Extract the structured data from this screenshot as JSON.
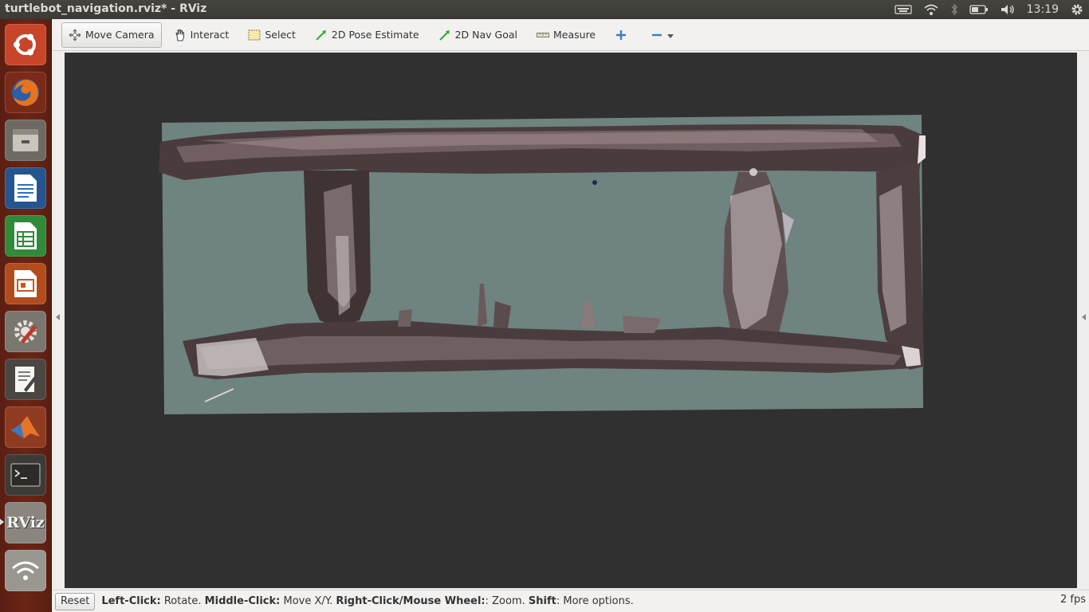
{
  "window": {
    "title": "turtlebot_navigation.rviz* - RViz"
  },
  "tray": {
    "clock": "13:19",
    "icons": [
      "keyboard-icon",
      "wifi-icon",
      "bluetooth-icon",
      "battery-icon",
      "volume-icon",
      "settings-gear-icon"
    ]
  },
  "launcher": {
    "items": [
      {
        "name": "ubuntu-dash-icon"
      },
      {
        "name": "firefox-icon"
      },
      {
        "name": "files-icon"
      },
      {
        "name": "writer-icon"
      },
      {
        "name": "calc-icon"
      },
      {
        "name": "impress-icon"
      },
      {
        "name": "system-settings-icon"
      },
      {
        "name": "text-editor-icon"
      },
      {
        "name": "matlab-icon"
      },
      {
        "name": "terminal-icon"
      },
      {
        "name": "rviz-icon",
        "label": "RViz"
      },
      {
        "name": "network-icon"
      }
    ]
  },
  "toolbar": {
    "move_camera": "Move Camera",
    "interact": "Interact",
    "select": "Select",
    "pose_estimate": "2D Pose Estimate",
    "nav_goal": "2D Nav Goal",
    "measure": "Measure"
  },
  "status": {
    "reset": "Reset",
    "hint_left_click": "Left-Click:",
    "hint_rotate": " Rotate. ",
    "hint_middle_click": "Middle-Click:",
    "hint_move": " Move X/Y. ",
    "hint_right_click": "Right-Click/Mouse Wheel:",
    "hint_zoom": ": Zoom. ",
    "hint_shift": "Shift",
    "hint_more": ": More options.",
    "fps": "2 fps"
  },
  "colors": {
    "map_floor": "#6f8380",
    "viewport_bg": "#303030",
    "launcher_bg": "#6b2515"
  }
}
